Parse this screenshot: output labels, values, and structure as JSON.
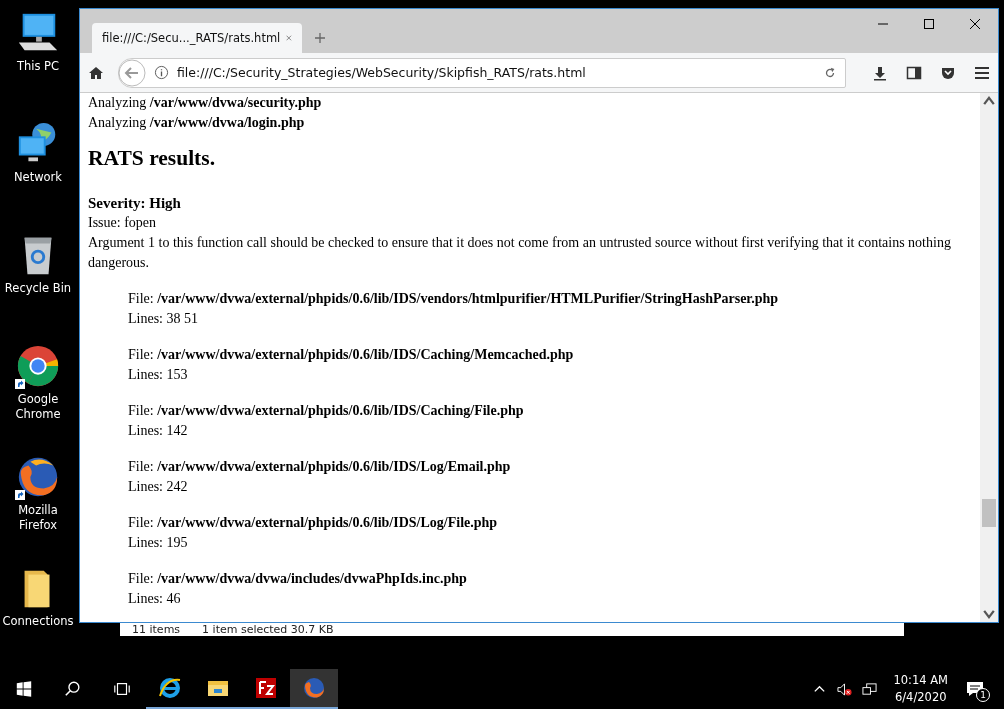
{
  "desktop_icons": [
    {
      "kind": "pc",
      "label": "This PC",
      "shortcut": false
    },
    {
      "kind": "network",
      "label": "Network",
      "shortcut": false
    },
    {
      "kind": "bin",
      "label": "Recycle Bin",
      "shortcut": false
    },
    {
      "kind": "chrome",
      "label": "Google Chrome",
      "shortcut": true
    },
    {
      "kind": "firefox",
      "label": "Mozilla Firefox",
      "shortcut": true
    },
    {
      "kind": "folder",
      "label": "Connections",
      "shortcut": false
    }
  ],
  "browser": {
    "tab_title": "file:///C:/Secu..._RATS/rats.html",
    "url": "file:///C:/Security_Strategies/WebSecurity/Skipfish_RATS/rats.html",
    "content": {
      "analyzing": [
        {
          "prefix": "Analyzing",
          "path": "/var/www/dvwa/security.php"
        },
        {
          "prefix": "Analyzing",
          "path": "/var/www/dvwa/login.php"
        }
      ],
      "heading": "RATS results.",
      "severity": "Severity: High",
      "issue": "Issue: fopen",
      "description": "Argument 1 to this function call should be checked to ensure that it does not come from an untrusted source without first verifying that it contains nothing dangerous.",
      "files": [
        {
          "label": "File:",
          "path": "/var/www/dvwa/external/phpids/0.6/lib/IDS/vendors/htmlpurifier/HTMLPurifier/StringHashParser.php",
          "lines": "Lines: 38 51"
        },
        {
          "label": "File:",
          "path": "/var/www/dvwa/external/phpids/0.6/lib/IDS/Caching/Memcached.php",
          "lines": "Lines: 153"
        },
        {
          "label": "File:",
          "path": "/var/www/dvwa/external/phpids/0.6/lib/IDS/Caching/File.php",
          "lines": "Lines: 142"
        },
        {
          "label": "File:",
          "path": "/var/www/dvwa/external/phpids/0.6/lib/IDS/Log/Email.php",
          "lines": "Lines: 242"
        },
        {
          "label": "File:",
          "path": "/var/www/dvwa/external/phpids/0.6/lib/IDS/Log/File.php",
          "lines": "Lines: 195"
        },
        {
          "label": "File:",
          "path": "/var/www/dvwa/dvwa/includes/dvwaPhpIds.inc.php",
          "lines": "Lines: 46"
        }
      ]
    }
  },
  "explorer_status": {
    "items": "11 items",
    "selected": "1 item selected  30.7 KB"
  },
  "taskbar": {
    "apps": [
      {
        "kind": "ie",
        "active": false
      },
      {
        "kind": "explorer",
        "active": false
      },
      {
        "kind": "filezilla",
        "active": false
      },
      {
        "kind": "firefox",
        "active": true
      }
    ],
    "time": "10:14 AM",
    "date": "6/4/2020",
    "notifications": "1"
  }
}
